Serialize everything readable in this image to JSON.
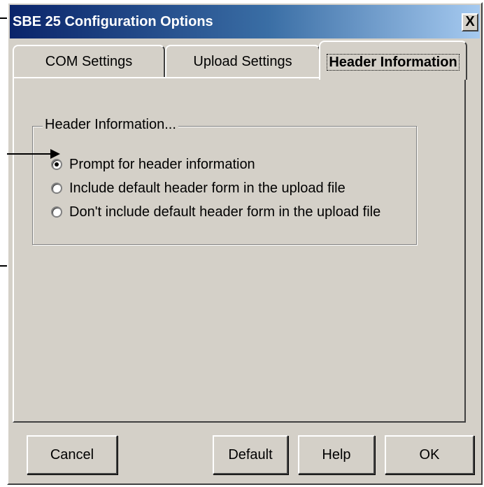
{
  "window": {
    "title": "SBE 25 Configuration Options",
    "close_label": "X"
  },
  "tabs": [
    {
      "label": "COM Settings",
      "active": false
    },
    {
      "label": "Upload Settings",
      "active": false
    },
    {
      "label": "Header Information",
      "active": true
    }
  ],
  "group": {
    "label": "Header Information...",
    "options": [
      {
        "label": "Prompt for header information",
        "selected": true
      },
      {
        "label": "Include default header form in the upload file",
        "selected": false
      },
      {
        "label": "Don't include default header form in the upload file",
        "selected": false
      }
    ]
  },
  "buttons": {
    "cancel": "Cancel",
    "default": "Default",
    "help": "Help",
    "ok": "OK"
  }
}
